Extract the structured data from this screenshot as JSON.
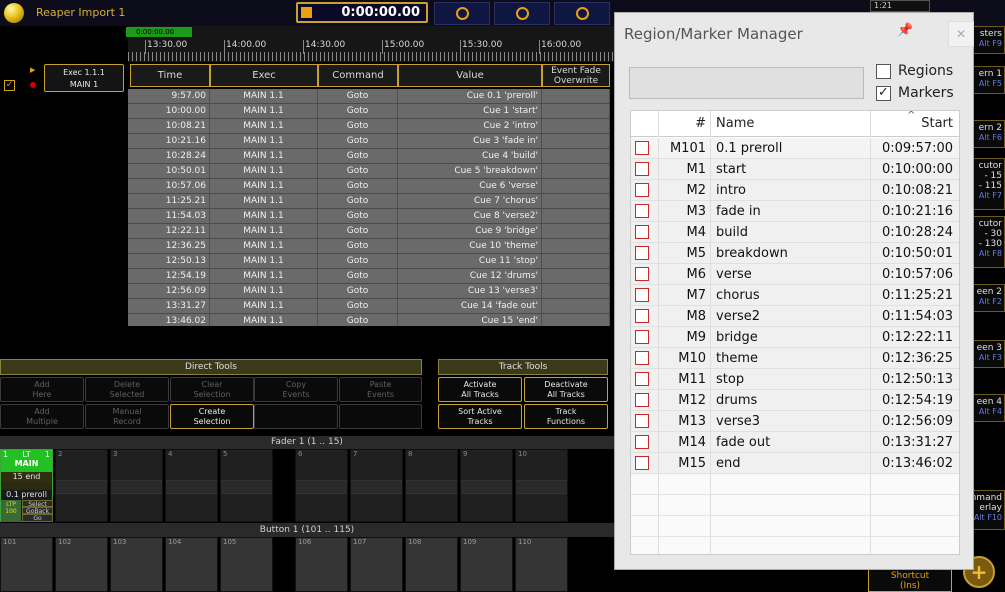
{
  "app": {
    "title": "Reaper Import 1",
    "timecode": "0:00:00.00"
  },
  "timeline": {
    "marker_label": "0:00:00.00",
    "ticks": [
      "13:30.00",
      "14:00.00",
      "14:30.00",
      "15:00.00",
      "15:30.00",
      "16:00.00"
    ]
  },
  "track": {
    "exec_line1": "Exec 1.1.1",
    "exec_line2": "MAIN 1"
  },
  "table": {
    "headers": [
      "Time",
      "Exec",
      "Command",
      "Value",
      "Event Fade Overwrite"
    ],
    "rows": [
      [
        "9:57.00",
        "MAIN 1.1",
        "Goto",
        "Cue 0.1 'preroll'"
      ],
      [
        "10:00.00",
        "MAIN 1.1",
        "Goto",
        "Cue 1 'start'"
      ],
      [
        "10:08.21",
        "MAIN 1.1",
        "Goto",
        "Cue 2 'intro'"
      ],
      [
        "10:21.16",
        "MAIN 1.1",
        "Goto",
        "Cue 3 'fade in'"
      ],
      [
        "10:28.24",
        "MAIN 1.1",
        "Goto",
        "Cue 4 'build'"
      ],
      [
        "10:50.01",
        "MAIN 1.1",
        "Goto",
        "Cue 5 'breakdown'"
      ],
      [
        "10:57.06",
        "MAIN 1.1",
        "Goto",
        "Cue 6 'verse'"
      ],
      [
        "11:25.21",
        "MAIN 1.1",
        "Goto",
        "Cue 7 'chorus'"
      ],
      [
        "11:54.03",
        "MAIN 1.1",
        "Goto",
        "Cue 8 'verse2'"
      ],
      [
        "12:22.11",
        "MAIN 1.1",
        "Goto",
        "Cue 9 'bridge'"
      ],
      [
        "12:36.25",
        "MAIN 1.1",
        "Goto",
        "Cue 10 'theme'"
      ],
      [
        "12:50.13",
        "MAIN 1.1",
        "Goto",
        "Cue 11 'stop'"
      ],
      [
        "12:54.19",
        "MAIN 1.1",
        "Goto",
        "Cue 12 'drums'"
      ],
      [
        "12:56.09",
        "MAIN 1.1",
        "Goto",
        "Cue 13 'verse3'"
      ],
      [
        "13:31.27",
        "MAIN 1.1",
        "Goto",
        "Cue 14 'fade out'"
      ],
      [
        "13:46.02",
        "MAIN 1.1",
        "Goto",
        "Cue 15 'end'"
      ]
    ]
  },
  "direct_tools": {
    "title": "Direct Tools",
    "buttons": [
      {
        "l1": "Add",
        "l2": "Here"
      },
      {
        "l1": "Delete",
        "l2": "Selected"
      },
      {
        "l1": "Clear",
        "l2": "Selection"
      },
      {
        "l1": "Copy",
        "l2": "Events"
      },
      {
        "l1": "Paste",
        "l2": "Events"
      },
      {
        "l1": "Add",
        "l2": "Multiple"
      },
      {
        "l1": "Manual",
        "l2": "Record"
      },
      {
        "l1": "Create",
        "l2": "Selection"
      }
    ]
  },
  "track_tools": {
    "title": "Track Tools",
    "buttons": [
      {
        "l1": "Activate",
        "l2": "All Tracks"
      },
      {
        "l1": "Deactivate",
        "l2": "All Tracks"
      },
      {
        "l1": "Sort Active",
        "l2": "Tracks"
      },
      {
        "l1": "Track",
        "l2": "Functions"
      }
    ]
  },
  "faders": {
    "header": "Fader  1 (1 .. 15)",
    "exec": {
      "num": "1",
      "lt": "LT",
      "num2": "1",
      "name": "MAIN",
      "cue": "15 end",
      "cue2": "0.1 preroll",
      "ltp": "LTP",
      "pct": "100",
      "b1": "Select",
      "b2": "GoBack",
      "b3": "Go"
    },
    "nums": [
      "2",
      "3",
      "4",
      "5",
      "6",
      "7",
      "8",
      "9",
      "10",
      "11"
    ]
  },
  "buttons": {
    "header": "Button  1 (101 .. 115)",
    "nums": [
      "101",
      "102",
      "103",
      "104",
      "105",
      "106",
      "107",
      "108",
      "109",
      "110",
      "111"
    ]
  },
  "right_strip": [
    {
      "l1": "sters",
      "l2": "Alt F9"
    },
    {
      "l1": "ern 1",
      "l2": "Alt F5"
    },
    {
      "l1": "ern 2",
      "l2": "Alt F6"
    },
    {
      "l1": "cutor",
      "l2": "- 15",
      "l3": "- 115",
      "l4": "Alt F7"
    },
    {
      "l1": "cutor",
      "l2": "- 30",
      "l3": "- 130",
      "l4": "Alt F8"
    },
    {
      "l1": "een 2",
      "l2": "Alt F2"
    },
    {
      "l1": "een 3",
      "l2": "Alt F3"
    },
    {
      "l1": "een 4",
      "l2": "Alt F4"
    },
    {
      "l1": "nmand",
      "l2": "erlay",
      "l3": "Alt F10"
    }
  ],
  "shortcut": {
    "l1": "Shortcut",
    "l2": "(Ins)"
  },
  "top_right": "1:21",
  "dialog": {
    "title": "Region/Marker Manager",
    "regions_label": "Regions",
    "markers_label": "Markers",
    "regions_checked": false,
    "markers_checked": true,
    "columns": [
      "#",
      "Name",
      "Start"
    ],
    "rows": [
      [
        "M101",
        "0.1 preroll",
        "0:09:57:00"
      ],
      [
        "M1",
        "start",
        "0:10:00:00"
      ],
      [
        "M2",
        "intro",
        "0:10:08:21"
      ],
      [
        "M3",
        "fade in",
        "0:10:21:16"
      ],
      [
        "M4",
        "build",
        "0:10:28:24"
      ],
      [
        "M5",
        "breakdown",
        "0:10:50:01"
      ],
      [
        "M6",
        "verse",
        "0:10:57:06"
      ],
      [
        "M7",
        "chorus",
        "0:11:25:21"
      ],
      [
        "M8",
        "verse2",
        "0:11:54:03"
      ],
      [
        "M9",
        "bridge",
        "0:12:22:11"
      ],
      [
        "M10",
        "theme",
        "0:12:36:25"
      ],
      [
        "M11",
        "stop",
        "0:12:50:13"
      ],
      [
        "M12",
        "drums",
        "0:12:54:19"
      ],
      [
        "M13",
        "verse3",
        "0:12:56:09"
      ],
      [
        "M14",
        "fade out",
        "0:13:31:27"
      ],
      [
        "M15",
        "end",
        "0:13:46:02"
      ]
    ]
  }
}
